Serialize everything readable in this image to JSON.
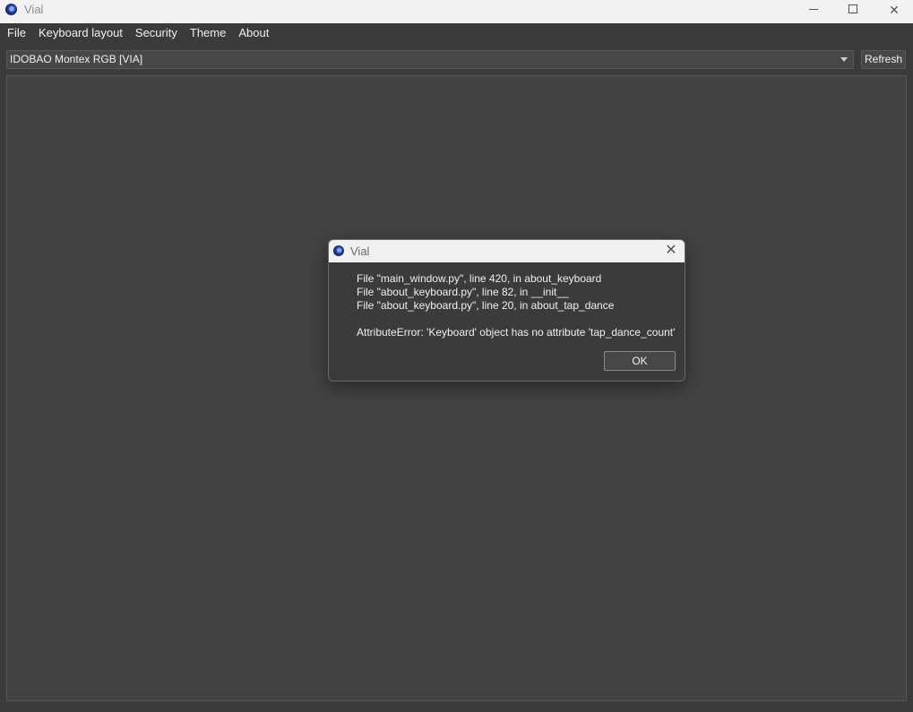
{
  "window": {
    "title": "Vial",
    "icon": "vial-app-icon",
    "controls": {
      "minimize": "minimize-icon",
      "maximize": "maximize-icon",
      "close": "✕"
    }
  },
  "menu": {
    "items": [
      "File",
      "Keyboard layout",
      "Security",
      "Theme",
      "About"
    ]
  },
  "device_selector": {
    "selected": "IDOBAO Montex RGB [VIA]",
    "arrow_icon": "chevron-down-icon"
  },
  "toolbar": {
    "refresh_label": "Refresh"
  },
  "dialog": {
    "title": "Vial",
    "close": "✕",
    "traceback": [
      "File \"main_window.py\", line 420, in about_keyboard",
      "File \"about_keyboard.py\", line 82, in __init__",
      "File \"about_keyboard.py\", line 20, in about_tap_dance"
    ],
    "error": "AttributeError: 'Keyboard' object has no attribute 'tap_dance_count'",
    "ok_label": "OK"
  },
  "colors": {
    "background": "#3b3b3b",
    "panel": "#434343",
    "titlebar": "#f2f2f2",
    "text": "#f0f0f0"
  }
}
